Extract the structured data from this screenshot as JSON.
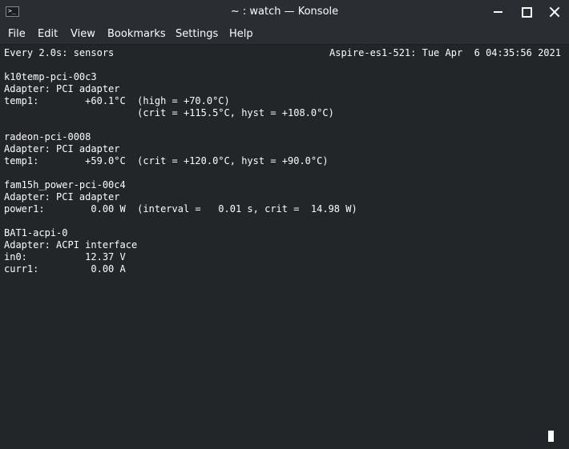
{
  "window": {
    "title": "~ : watch — Konsole",
    "app_icon_glyph": ">_",
    "buttons": [
      "minimize",
      "maximize",
      "close"
    ]
  },
  "menubar": {
    "items": [
      "File",
      "Edit",
      "View",
      "Bookmarks",
      "Settings",
      "Help"
    ]
  },
  "terminal": {
    "header_left": "Every 2.0s: sensors",
    "header_right": "Aspire-es1-521: Tue Apr  6 04:35:56 2021",
    "lines": [
      "k10temp-pci-00c3",
      "Adapter: PCI adapter",
      "temp1:        +60.1°C  (high = +70.0°C)",
      "                       (crit = +115.5°C, hyst = +108.0°C)",
      "",
      "radeon-pci-0008",
      "Adapter: PCI adapter",
      "temp1:        +59.0°C  (crit = +120.0°C, hyst = +90.0°C)",
      "",
      "fam15h_power-pci-00c4",
      "Adapter: PCI adapter",
      "power1:        0.00 W  (interval =   0.01 s, crit =  14.98 W)",
      "",
      "BAT1-acpi-0",
      "Adapter: ACPI interface",
      "in0:          12.37 V",
      "curr1:         0.00 A"
    ]
  },
  "colors": {
    "background": "#232629",
    "titlebar": "#2a2e32",
    "text": "#fcfcfc"
  }
}
